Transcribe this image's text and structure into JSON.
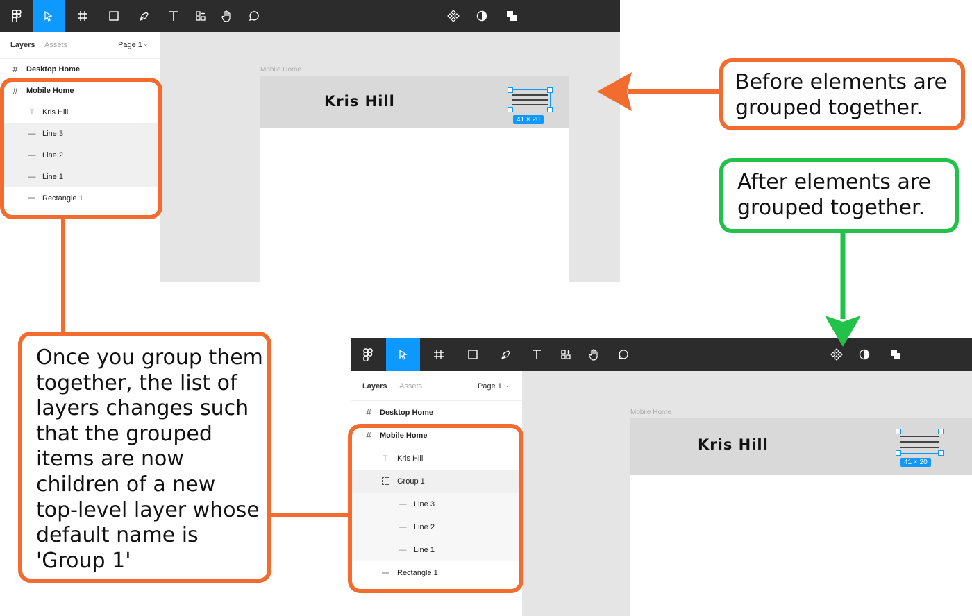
{
  "top_window": {
    "tabs": {
      "layers": "Layers",
      "assets": "Assets",
      "page": "Page 1"
    },
    "layers": [
      {
        "name": "Desktop Home",
        "icon": "frame-icon",
        "bold": true
      },
      {
        "name": "Mobile Home",
        "icon": "frame-icon",
        "bold": true
      },
      {
        "name": "Kris Hill",
        "icon": "text-icon"
      },
      {
        "name": "Line 3",
        "icon": "line-icon"
      },
      {
        "name": "Line 2",
        "icon": "line-icon"
      },
      {
        "name": "Line 1",
        "icon": "line-icon"
      },
      {
        "name": "Rectangle 1",
        "icon": "rectangle-icon"
      }
    ],
    "frame_label": "Mobile Home",
    "logo": "Kris Hill",
    "dimension_badge": "41 × 20"
  },
  "bottom_window": {
    "tabs": {
      "layers": "Layers",
      "assets": "Assets",
      "page": "Page 1"
    },
    "layers": [
      {
        "name": "Desktop Home",
        "icon": "frame-icon",
        "bold": true
      },
      {
        "name": "Mobile Home",
        "icon": "frame-icon",
        "bold": true
      },
      {
        "name": "Kris Hill",
        "icon": "text-icon"
      },
      {
        "name": "Group 1",
        "icon": "group-icon"
      },
      {
        "name": "Line 3",
        "icon": "line-icon"
      },
      {
        "name": "Line 2",
        "icon": "line-icon"
      },
      {
        "name": "Line 1",
        "icon": "line-icon"
      },
      {
        "name": "Rectangle 1",
        "icon": "rectangle-icon"
      }
    ],
    "frame_label": "Mobile Home",
    "logo": "Kris Hill",
    "dimension_badge": "41 × 20"
  },
  "callouts": {
    "before": "Before elements are grouped together.",
    "after": "After elements are grouped together.",
    "explanation": "Once you group them together, the list of layers changes such that the grouped items are now children of a new top-level layer whose default name is 'Group 1'"
  },
  "colors": {
    "toolbar": "#2c2c2c",
    "active_tool": "#0d99ff",
    "orange": "#f26b2f",
    "green": "#22c24a",
    "selection": "#0d99ff"
  }
}
